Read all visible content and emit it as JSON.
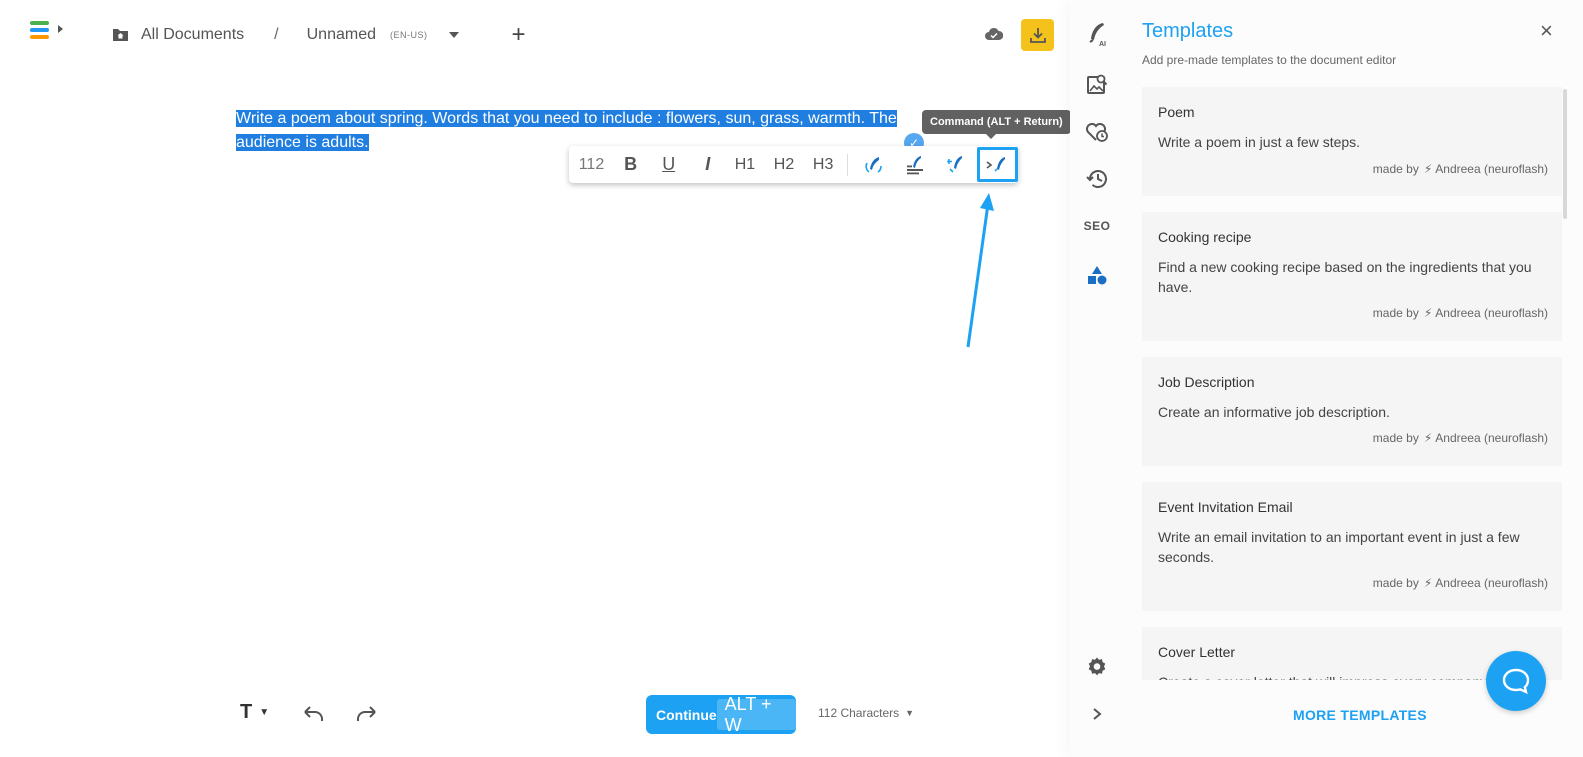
{
  "header": {
    "breadcrumb_root": "All Documents",
    "separator": "/",
    "document_name": "Unnamed",
    "language": "(EN-US)",
    "add_label": "+"
  },
  "editor": {
    "text": "Write a poem about spring. Words that you need to include : flowers, sun, grass, warmth. The audience is adults.",
    "check_badge": "✓"
  },
  "toolbar": {
    "char_count": "112",
    "bold": "B",
    "underline": "U",
    "italic": "I",
    "h1": "H1",
    "h2": "H2",
    "h3": "H3",
    "tooltip": "Command (ALT + Return)"
  },
  "bottom_bar": {
    "text_style": "T",
    "continue_label": "Continue",
    "continue_shortcut": "ALT + W",
    "characters": "112 Characters"
  },
  "rail": {
    "ai_label": "AI",
    "seo_label": "SEO"
  },
  "panel": {
    "title": "Templates",
    "subtitle": "Add pre-made templates to the document editor",
    "close": "×",
    "more_label": "MORE TEMPLATES",
    "templates": [
      {
        "title": "Poem",
        "description": "Write a poem in just a few steps.",
        "made_by": "made by",
        "author": "Andreea (neuroflash)"
      },
      {
        "title": "Cooking recipe",
        "description": "Find a new cooking recipe based on the ingredients that you have.",
        "made_by": "made by",
        "author": "Andreea (neuroflash)"
      },
      {
        "title": "Job Description",
        "description": "Create an informative job description.",
        "made_by": "made by",
        "author": "Andreea (neuroflash)"
      },
      {
        "title": "Event Invitation Email",
        "description": "Write an email invitation to an important event in just a few seconds.",
        "made_by": "made by",
        "author": "Andreea (neuroflash)"
      },
      {
        "title": "Cover Letter",
        "description": "Create a cover letter that will impress every company.",
        "made_by": "",
        "author": ""
      }
    ]
  },
  "colors": {
    "accent": "#1da1f2",
    "selection": "#1f7ee0",
    "download": "#f4c21b"
  }
}
